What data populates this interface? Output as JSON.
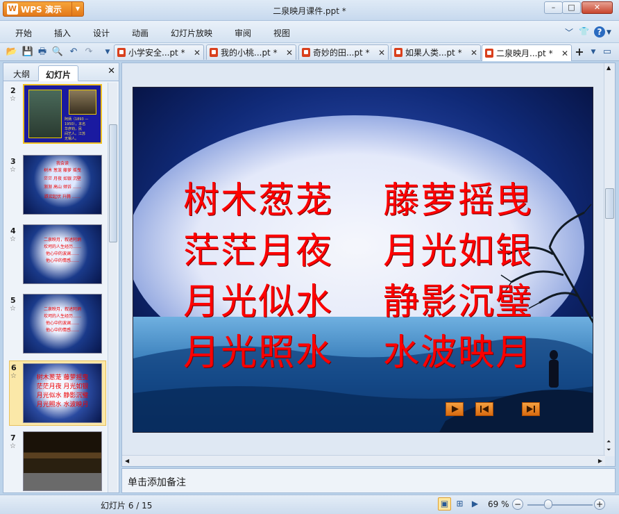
{
  "app": {
    "name": "WPS 演示",
    "logo_glyph": "W",
    "document_title": "二泉映月课件.ppt *"
  },
  "window_controls": {
    "minimize": "–",
    "maximize": "□",
    "close": "✕"
  },
  "menu": {
    "items": [
      "开始",
      "插入",
      "设计",
      "动画",
      "幻灯片放映",
      "审阅",
      "视图"
    ],
    "right_icons": [
      "chevron-down-icon",
      "shirt-icon",
      "help-icon",
      "chevron-down-icon"
    ]
  },
  "quick_access": [
    "open-icon",
    "save-icon",
    "print-icon",
    "print-preview-icon",
    "undo-icon",
    "redo-icon",
    "customize-icon"
  ],
  "doc_tabs": [
    {
      "label": "小学安全...pt *",
      "active": false
    },
    {
      "label": "我的小桃...pt *",
      "active": false
    },
    {
      "label": "奇妙的田...pt *",
      "active": false
    },
    {
      "label": "如果人类...pt *",
      "active": false
    },
    {
      "label": "二泉映月...pt *",
      "active": true
    }
  ],
  "tab_close_glyph": "✕",
  "new_tab_glyph": "+",
  "left_panel": {
    "tabs": [
      "大纲",
      "幻灯片"
    ],
    "active_tab": "幻灯片",
    "close_glyph": "✕",
    "thumbnails": [
      {
        "number": "2",
        "text_lines": [
          "阿炳（1893 —",
          "1950），本名",
          "华彦钧，民",
          "间艺人。江苏",
          "无锡人。"
        ]
      },
      {
        "number": "3",
        "text_lines": [
          "我会读",
          "树木  葱茏  藤萝  摇曳",
          "茫茫  月夜  如银  沉壁",
          "渐渐  高山  倾诉  ……",
          "跌宕起伏  升腾  ……"
        ]
      },
      {
        "number": "4",
        "text_lines": [
          "二泉映月，叙述阿炳",
          "坎坷的人生经历……",
          "他心中的波澜……",
          "他心中的情感……"
        ]
      },
      {
        "number": "5",
        "text_lines": [
          "二泉映月，叙述阿炳",
          "坎坷的人生经历……",
          "他心中的波澜……",
          "他心中的情感……"
        ]
      },
      {
        "number": "6",
        "text_lines": [
          "树木葱茏  藤萝摇曳",
          "茫茫月夜  月光如银",
          "月光似水  静影沉璧",
          "月光照水  水波映月"
        ]
      },
      {
        "number": "7",
        "text_lines": []
      }
    ],
    "star_glyph": "☆"
  },
  "slide": {
    "lines": [
      [
        "树木葱茏",
        "藤萝摇曳"
      ],
      [
        "茫茫月夜",
        "月光如银"
      ],
      [
        "月光似水",
        "静影沉璧"
      ],
      [
        "月光照水",
        "水波映月"
      ]
    ],
    "nav_buttons": [
      "play-icon",
      "first-icon",
      "last-icon"
    ],
    "text_color": "#ff0000"
  },
  "notes_placeholder": "单击添加备注",
  "status": {
    "slide_count": "幻灯片 6 / 15",
    "zoom": "69 %",
    "zoom_level_percent": 69,
    "zoom_minus": "−",
    "zoom_plus": "+"
  },
  "colors": {
    "accent_orange": "#e2781a",
    "chrome_blue": "#c7d9ee",
    "selected_thumb": "#fbe8a8"
  }
}
